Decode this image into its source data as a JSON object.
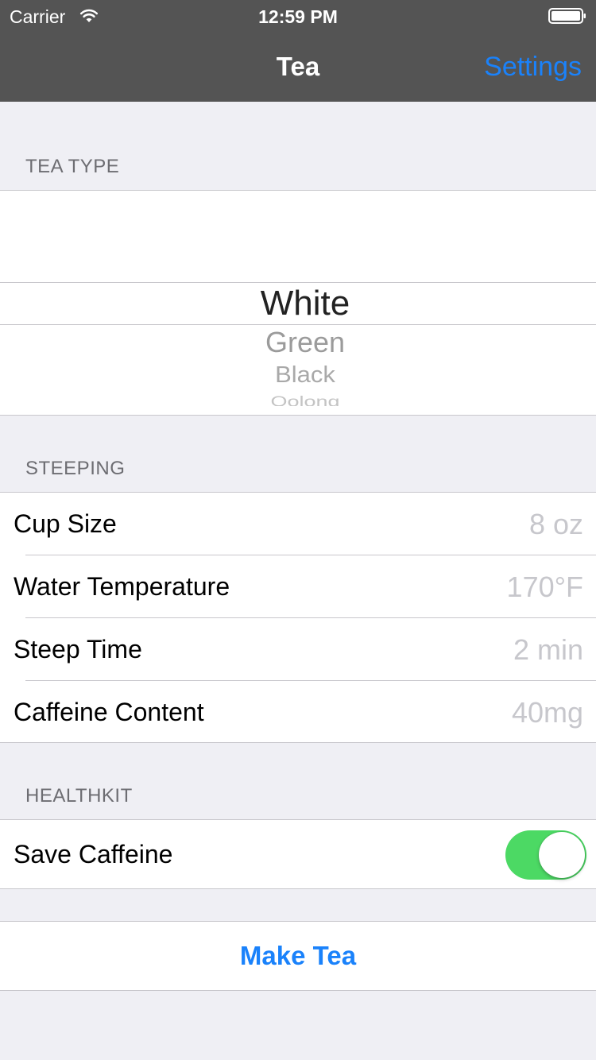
{
  "status_bar": {
    "carrier": "Carrier",
    "time": "12:59 PM"
  },
  "nav": {
    "title": "Tea",
    "settings_label": "Settings"
  },
  "tea_type": {
    "header": "TEA TYPE",
    "options": [
      "White",
      "Green",
      "Black",
      "Oolong"
    ],
    "selected": "White"
  },
  "steeping": {
    "header": "STEEPING",
    "rows": [
      {
        "label": "Cup Size",
        "value": "8 oz"
      },
      {
        "label": "Water Temperature",
        "value": "170°F"
      },
      {
        "label": "Steep Time",
        "value": "2 min"
      },
      {
        "label": "Caffeine Content",
        "value": "40mg"
      }
    ]
  },
  "healthkit": {
    "header": "HEALTHKIT",
    "save_caffeine_label": "Save Caffeine",
    "save_caffeine_on": true
  },
  "actions": {
    "make_tea_label": "Make Tea"
  },
  "colors": {
    "nav_bar": "#545454",
    "accent": "#1a82fb",
    "toggle_on": "#4cd964",
    "background": "#efeff4",
    "value_text": "#c7c7cc"
  }
}
